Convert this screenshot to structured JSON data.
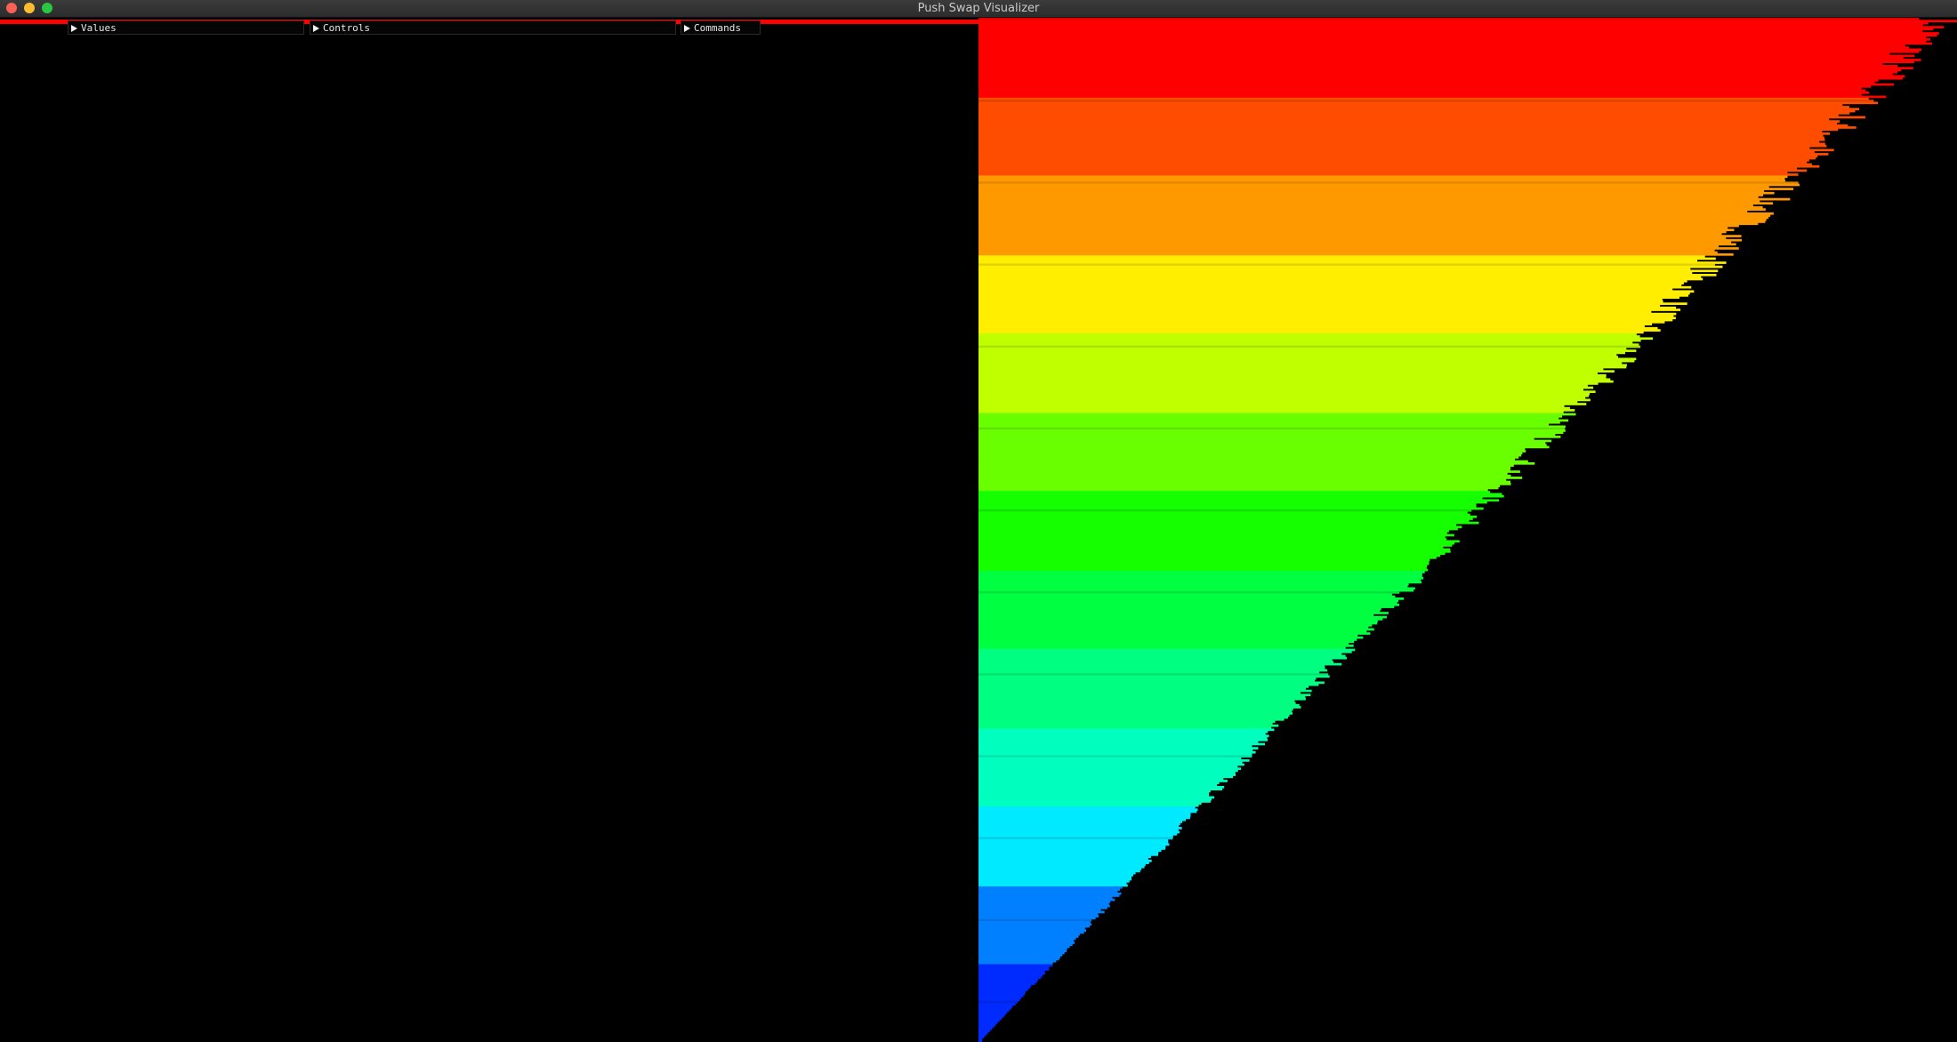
{
  "window": {
    "title": "Push Swap Visualizer"
  },
  "menus": {
    "values": "Values",
    "controls": "Controls",
    "commands": "Commands"
  },
  "stack_a": {
    "count": 0,
    "progress": 1.0,
    "progress_color": "#ff0000"
  },
  "stack_b": {
    "count": 500,
    "min_value": 1,
    "max_value": 500,
    "direction_note": "",
    "color_scheme": "rainbow-by-value",
    "ordering_bands": [
      {
        "hue": 0,
        "from": 500,
        "to": 460
      },
      {
        "hue": 18,
        "from": 460,
        "to": 420
      },
      {
        "hue": 36,
        "from": 420,
        "to": 380
      },
      {
        "hue": 56,
        "from": 380,
        "to": 340
      },
      {
        "hue": 75,
        "from": 340,
        "to": 300
      },
      {
        "hue": 95,
        "from": 300,
        "to": 260
      },
      {
        "hue": 115,
        "from": 260,
        "to": 220
      },
      {
        "hue": 135,
        "from": 220,
        "to": 180
      },
      {
        "hue": 150,
        "from": 180,
        "to": 140
      },
      {
        "hue": 165,
        "from": 140,
        "to": 100
      },
      {
        "hue": 185,
        "from": 100,
        "to": 60
      },
      {
        "hue": 210,
        "from": 60,
        "to": 20
      },
      {
        "hue": 230,
        "from": 20,
        "to": 0
      }
    ]
  }
}
